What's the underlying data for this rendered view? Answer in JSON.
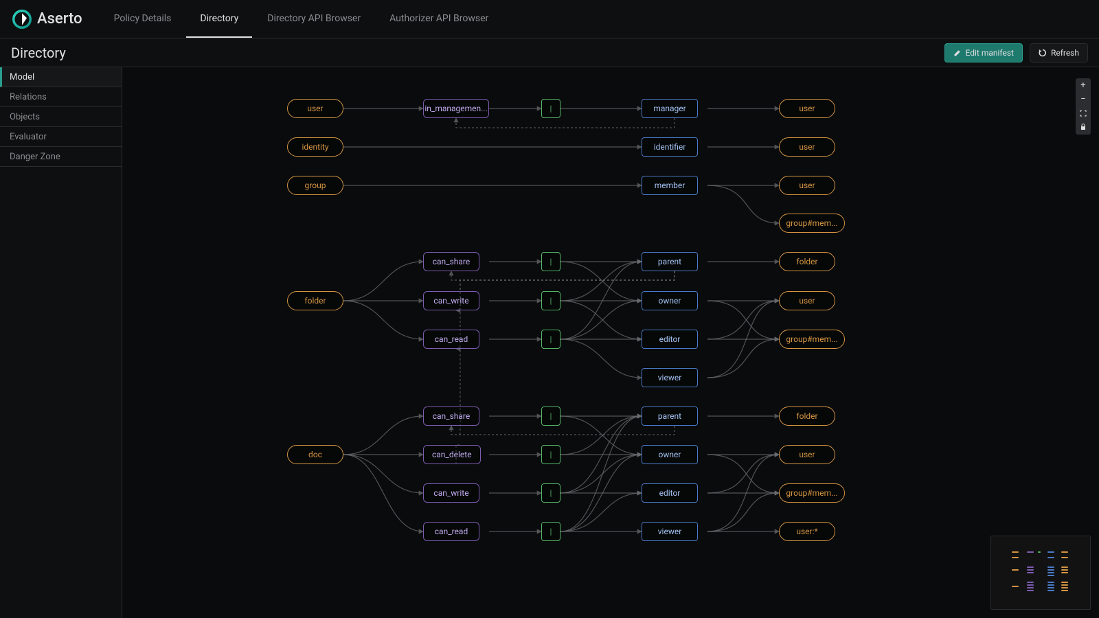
{
  "brand": "Aserto",
  "nav": {
    "policy": "Policy Details",
    "directory": "Directory",
    "dir_api": "Directory API Browser",
    "auth_api": "Authorizer API Browser"
  },
  "page_title": "Directory",
  "actions": {
    "edit": "Edit manifest",
    "refresh": "Refresh"
  },
  "sidebar": {
    "model": "Model",
    "relations": "Relations",
    "objects": "Objects",
    "evaluator": "Evaluator",
    "danger": "Danger Zone"
  },
  "nodes": {
    "user_obj": "user",
    "in_mgmt": "in_managemen...",
    "op1": "|",
    "manager": "manager",
    "user_s1": "user",
    "identity_obj": "identity",
    "identifier": "identifier",
    "user_s2": "user",
    "group_obj": "group",
    "member": "member",
    "user_s3": "user",
    "gm1": "group#mem...",
    "folder_obj": "folder",
    "f_share": "can_share",
    "f_write": "can_write",
    "f_read": "can_read",
    "op2": "|",
    "op3": "|",
    "op4": "|",
    "parent1": "parent",
    "owner1": "owner",
    "editor1": "editor",
    "viewer1": "viewer",
    "folder_s1": "folder",
    "user_s4": "user",
    "gm2": "group#mem...",
    "doc_obj": "doc",
    "d_share": "can_share",
    "d_delete": "can_delete",
    "d_write": "can_write",
    "d_read": "can_read",
    "op5": "|",
    "op6": "|",
    "op7": "|",
    "op8": "|",
    "parent2": "parent",
    "owner2": "owner",
    "editor2": "editor",
    "viewer2": "viewer",
    "folder_s2": "folder",
    "user_s5": "user",
    "gm3": "group#mem...",
    "user_star": "user:*"
  },
  "colors": {
    "orange": "#d49543",
    "purple": "#7c5db0",
    "green": "#54b56a",
    "blue": "#4a7bc8"
  }
}
